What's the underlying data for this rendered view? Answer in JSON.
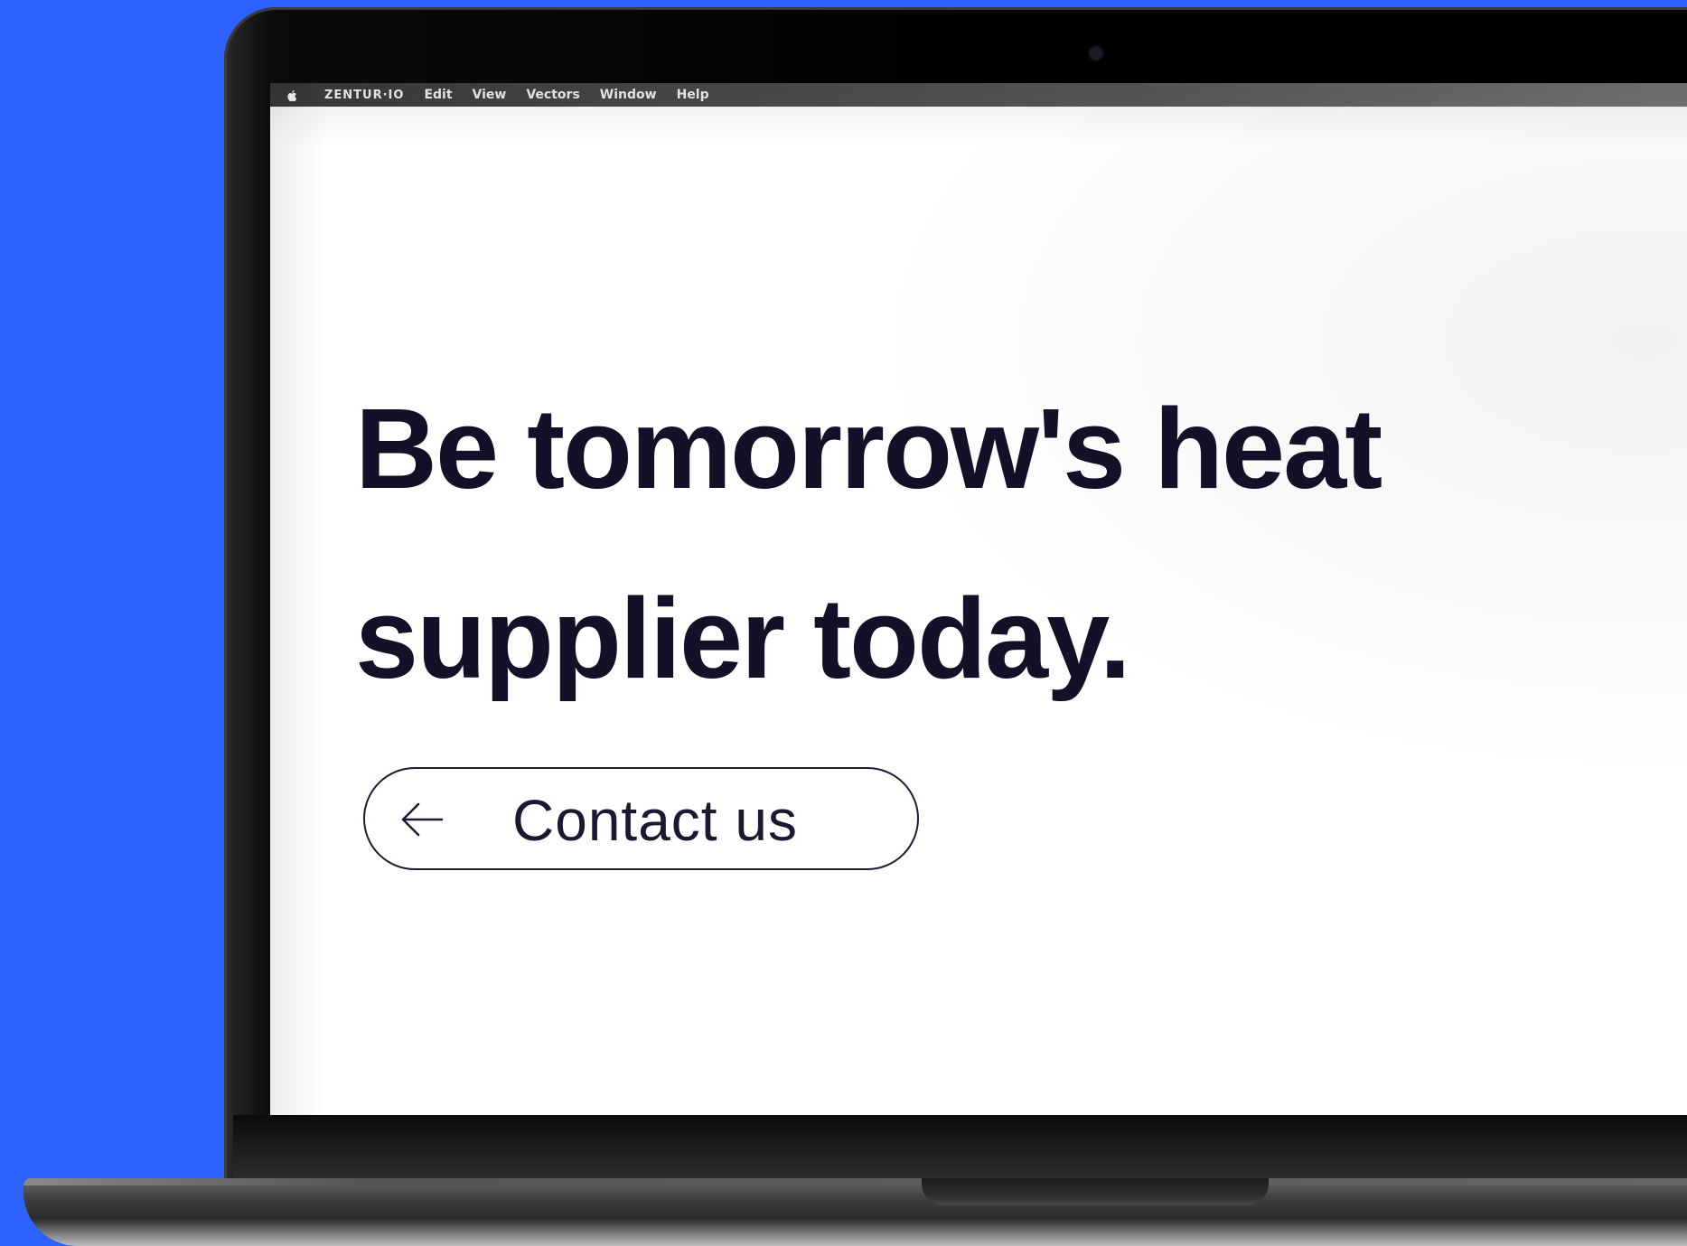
{
  "menubar": {
    "app_name": "ZENTUR·IO",
    "items": [
      {
        "label": "Edit"
      },
      {
        "label": "View"
      },
      {
        "label": "Vectors"
      },
      {
        "label": "Window"
      },
      {
        "label": "Help"
      }
    ],
    "apple_icon": "apple-logo-icon"
  },
  "hero": {
    "headline_line1": "Be tomorrow's heat",
    "headline_line2": "supplier today.",
    "cta_label": "Contact us",
    "cta_icon": "arrow-left-icon"
  },
  "colors": {
    "background": "#2d62ff",
    "headline": "#121127",
    "screen": "#ffffff"
  }
}
